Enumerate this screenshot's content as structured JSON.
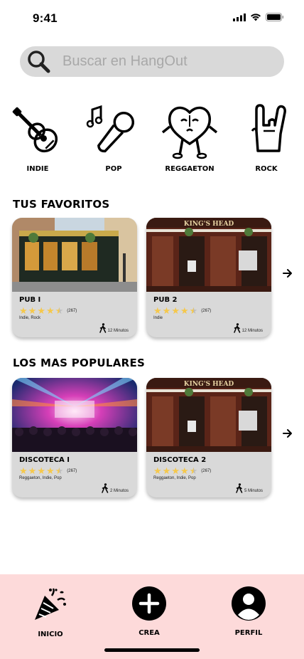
{
  "status_bar": {
    "time": "9:41"
  },
  "search": {
    "placeholder": "Buscar en HangOut"
  },
  "genres": [
    {
      "label": "INDIE",
      "icon": "guitar-icon"
    },
    {
      "label": "POP",
      "icon": "microphone-icon"
    },
    {
      "label": "REGGAETON",
      "icon": "heart-character-icon"
    },
    {
      "label": "ROCK",
      "icon": "rock-hand-icon"
    }
  ],
  "favorites": {
    "title": "TUS FAVORITOS",
    "cards": [
      {
        "name": "PUB I",
        "rating": 4.5,
        "count": "(267)",
        "tags": "Indie, Rock",
        "walk": "12 Minutos"
      },
      {
        "name": "PUB 2",
        "rating": 4.5,
        "count": "(267)",
        "tags": "Indie",
        "walk": "12 Minutos",
        "sign": "KING'S HEAD"
      }
    ]
  },
  "popular": {
    "title": "LOS MAS POPULARES",
    "cards": [
      {
        "name": "DISCOTECA I",
        "rating": 4.5,
        "count": "(267)",
        "tags": "Reggaeton, Indie, Pop",
        "walk": "2 Minutos"
      },
      {
        "name": "DISCOTECA 2",
        "rating": 4.5,
        "count": "(267)",
        "tags": "Reggaeton, Indie, Pop",
        "walk": "5 Minutos",
        "sign": "KING'S HEAD"
      }
    ]
  },
  "nav": {
    "home": "INICIO",
    "create": "CREA",
    "profile": "PERFIL"
  },
  "colors": {
    "nav_background": "#fddada",
    "card_background": "#d9d9d9",
    "star": "#f5c84b"
  }
}
